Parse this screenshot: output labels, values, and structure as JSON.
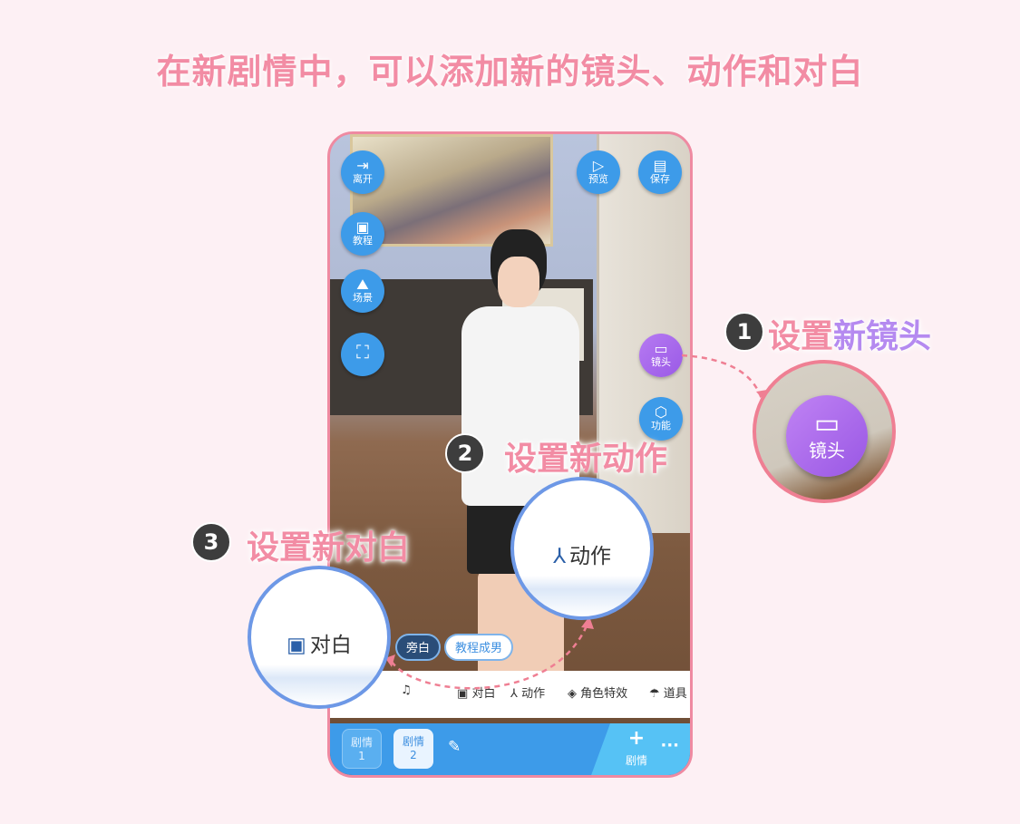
{
  "title": "在新剧情中，可以添加新的镜头、动作和对白",
  "phone": {
    "left_buttons": [
      {
        "name": "leave",
        "icon": "exit-icon",
        "glyph": "⇥",
        "label": "离开"
      },
      {
        "name": "tutorial",
        "icon": "book-icon",
        "glyph": "▣",
        "label": "教程"
      },
      {
        "name": "scene",
        "icon": "scene-icon",
        "glyph": "⛰",
        "label": "场景"
      },
      {
        "name": "fullscreen",
        "icon": "fullscreen-icon",
        "glyph": "⛶",
        "label": ""
      }
    ],
    "right_buttons": [
      {
        "name": "preview",
        "icon": "play-icon",
        "glyph": "▷",
        "label": "预览"
      },
      {
        "name": "save",
        "icon": "save-icon",
        "glyph": "▤",
        "label": "保存"
      }
    ],
    "camera_button": {
      "icon": "camera-icon",
      "glyph": "▭",
      "label": "镜头"
    },
    "function_button": {
      "icon": "cube-icon",
      "glyph": "⬡",
      "label": "功能"
    },
    "chips": {
      "narration": "旁白",
      "character": "教程成男"
    },
    "toolbar": [
      {
        "name": "audio",
        "icon": "audio-icon",
        "glyph": "♫",
        "label": ""
      },
      {
        "name": "dialogue",
        "icon": "dialogue-icon",
        "glyph": "▣",
        "label": "对白"
      },
      {
        "name": "action",
        "icon": "action-icon",
        "glyph": "⅄",
        "label": "动作"
      },
      {
        "name": "effect",
        "icon": "effect-icon",
        "glyph": "◈",
        "label": "角色特效"
      },
      {
        "name": "prop",
        "icon": "prop-icon",
        "glyph": "☂",
        "label": "道具"
      }
    ],
    "story_tabs": [
      {
        "line1": "剧情",
        "line2": "1"
      },
      {
        "line1": "剧情",
        "line2": "2"
      }
    ],
    "add_story": {
      "plus": "+",
      "label": "剧情"
    },
    "more": "···"
  },
  "callouts": {
    "step1": {
      "num": "1",
      "text_a": "设置",
      "text_b": "新镜头"
    },
    "step2": {
      "num": "2",
      "text": "设置新动作"
    },
    "step3": {
      "num": "3",
      "text": "设置新对白"
    },
    "zoom_camera_label": "镜头",
    "zoom_action_label": "动作",
    "zoom_dialogue_label": "对白"
  },
  "colors": {
    "background": "#fdf0f4",
    "title": "#f28ca4",
    "accent_blue": "#3d9be9",
    "accent_purple": "#a86bee",
    "phone_border": "#ef8aa1"
  }
}
